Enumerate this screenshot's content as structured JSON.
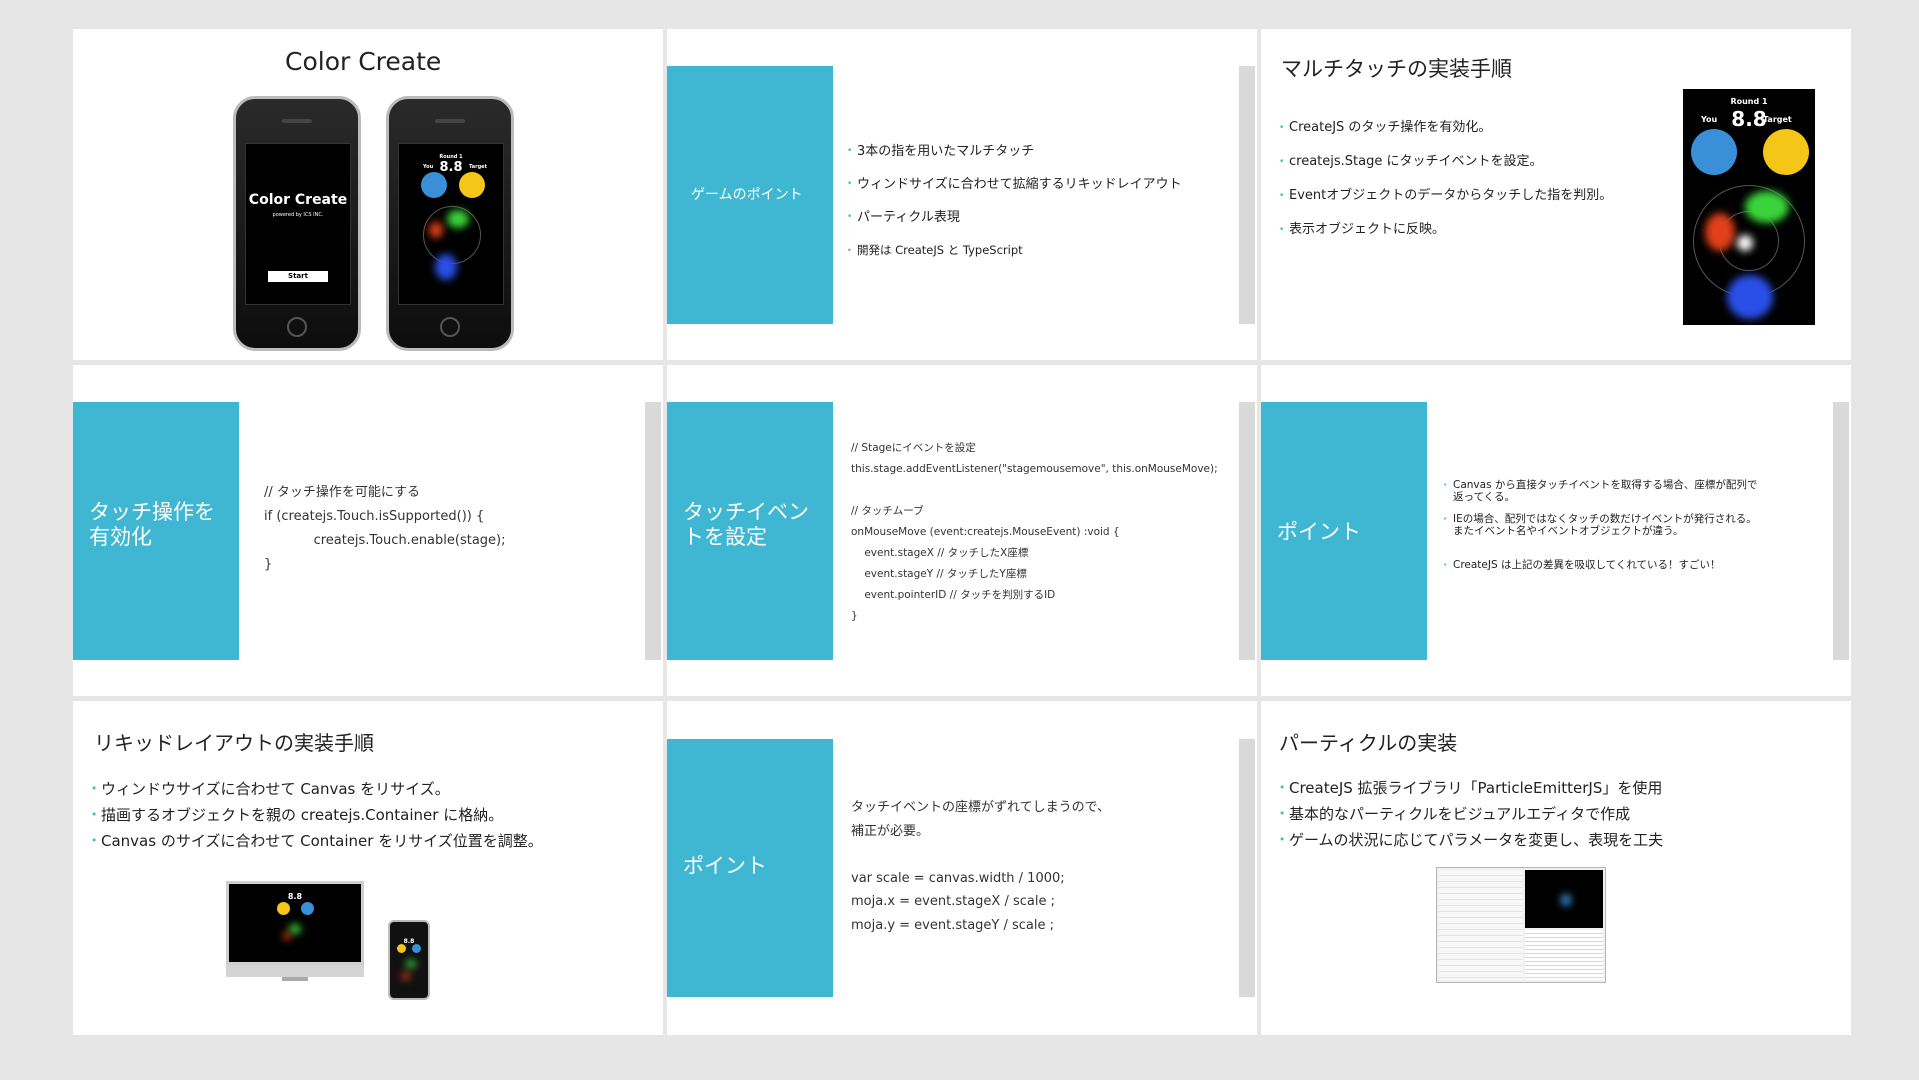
{
  "slides": {
    "s1": {
      "title": "Color Create",
      "phone1": {
        "app_title": "Color Create",
        "powered": "powered by ICS INC.",
        "start": "Start"
      },
      "phone2": {
        "round": "Round 1",
        "score": "8.8",
        "you": "You",
        "target": "Target"
      }
    },
    "s2": {
      "block_label": "ゲームのポイント",
      "bullets": [
        "3本の指を用いたマルチタッチ",
        "ウィンドサイズに合わせて拡縮するリキッドレイアウト",
        "パーティクル表現",
        "開発は CreateJS と TypeScript"
      ]
    },
    "s3": {
      "title": "マルチタッチの実装手順",
      "bullets": [
        "CreateJS のタッチ操作を有効化。",
        "createjs.Stage にタッチイベントを設定。",
        "Eventオブジェクトのデータからタッチした指を判別。",
        "表示オブジェクトに反映。"
      ],
      "game": {
        "round": "Round 1",
        "score": "8.8",
        "you": "You",
        "target": "Target"
      }
    },
    "s4": {
      "block_label": "タッチ操作を\n有効化",
      "code": "// タッチ操作を可能にする\nif (createjs.Touch.isSupported()) {\n            createjs.Touch.enable(stage);\n}"
    },
    "s5": {
      "block_label": "タッチイベン\nトを設定",
      "code": "// Stageにイベントを設定\nthis.stage.addEventListener(\"stagemousemove\", this.onMouseMove);\n\n// タッチムーブ\nonMouseMove (event:createjs.MouseEvent) :void {\n    event.stageX // タッチしたX座標\n    event.stageY // タッチしたY座標\n    event.pointerID // タッチを判別するID\n}"
    },
    "s6": {
      "block_label": "ポイント",
      "bullets": [
        "Canvas から直接タッチイベントを取得する場合、座標が配列で\n返ってくる。",
        "IEの場合、配列ではなくタッチの数だけイベントが発行される。\nまたイベント名やイベントオブジェクトが違う。",
        "CreateJS は上記の差異を吸収してくれている！すごい！"
      ]
    },
    "s7": {
      "title": "リキッドレイアウトの実装手順",
      "bullets": [
        "ウィンドウサイズに合わせて Canvas をリサイズ。",
        "描画するオブジェクトを親の createjs.Container に格納。",
        "Canvas のサイズに合わせて Container をリサイズ位置を調整。"
      ],
      "monitor_score": "8.8",
      "small_phone_score": "8.8"
    },
    "s8": {
      "block_label": "ポイント",
      "text": "タッチイベントの座標がずれてしまうので、\n補正が必要。\n\nvar scale = canvas.width / 1000;\nmoja.x = event.stageX / scale ;\nmoja.y = event.stageY / scale ;"
    },
    "s9": {
      "title": "パーティクルの実装",
      "bullets": [
        "CreateJS 拡張ライブラリ「ParticleEmitterJS」を使用",
        "基本的なパーティクルをビジュアルエディタで作成",
        "ゲームの状況に応じてパラメータを変更し、表現を工夫"
      ]
    }
  },
  "colors": {
    "accent": "#40b7d2",
    "background": "#e6e6e6",
    "slide": "#ffffff",
    "game_blue": "#3a8fd9",
    "game_yellow": "#f5c518"
  }
}
